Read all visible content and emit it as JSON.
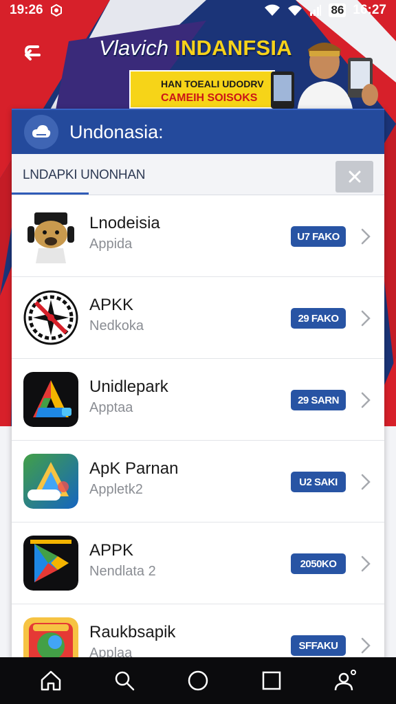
{
  "status_bar": {
    "time_left": "19:26",
    "time_right": "16:27",
    "battery_label": "86"
  },
  "banner": {
    "title_part1": "Vlavich ",
    "title_part2": "INDANFSIA",
    "promo_line1": "HAN TOEALI UDODRV",
    "promo_line2": "CAMEIH SOISOKS"
  },
  "card": {
    "title": "Undonasia:",
    "tab_label": "LNDAPKI UNONHAN"
  },
  "apps": [
    {
      "name": "Lnodeisia",
      "subtitle": "Appida",
      "badge": "U7 FAKO",
      "icon": "dog-headphones-icon"
    },
    {
      "name": "APKK",
      "subtitle": "Nedkoka",
      "badge": "29 FAKO",
      "icon": "compass-icon"
    },
    {
      "name": "Unidlepark",
      "subtitle": "Apptaa",
      "badge": "29 SARN",
      "icon": "triangle-logo-icon"
    },
    {
      "name": "ApK Parnan",
      "subtitle": "Appletk2",
      "badge": "U2 SAKI",
      "icon": "apoc-logo-icon"
    },
    {
      "name": "APPK",
      "subtitle": "Nendlata 2",
      "badge": "2050KO",
      "icon": "play-logo-icon"
    },
    {
      "name": "Raukbsapik",
      "subtitle": "Applaa",
      "badge": "SFFAKU",
      "icon": "colorful-box-icon"
    }
  ],
  "colors": {
    "primary": "#244a9c",
    "badge": "#2854a4",
    "banner_yellow": "#f6d418",
    "banner_red": "#d7202a"
  }
}
